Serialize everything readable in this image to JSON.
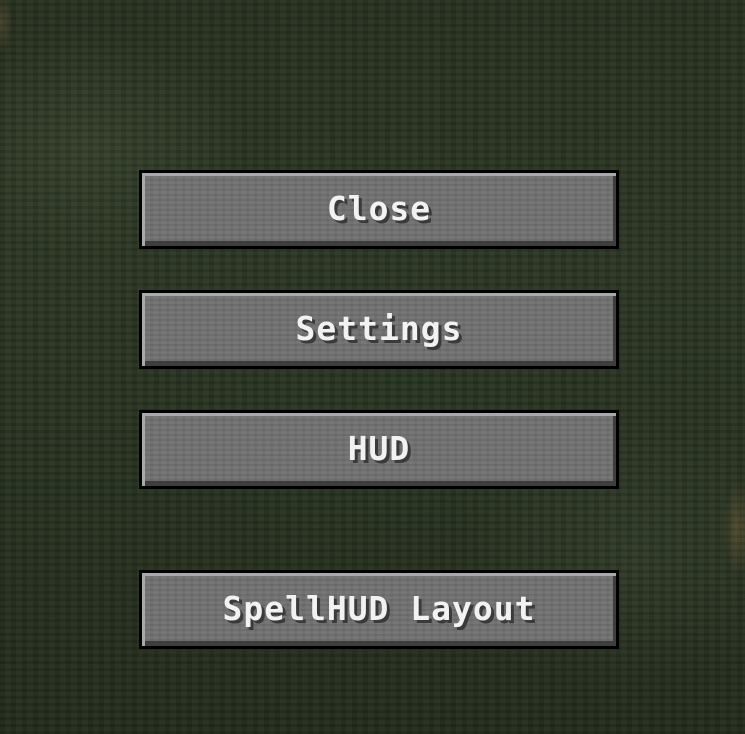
{
  "menu": {
    "buttons": [
      {
        "label": "Close"
      },
      {
        "label": "Settings"
      },
      {
        "label": "HUD"
      },
      {
        "label": "SpellHUD Layout"
      }
    ]
  },
  "colors": {
    "background": "#27301f",
    "button_face": "#6f6f6f",
    "button_border": "#000000",
    "button_text": "#f2f2f2"
  }
}
